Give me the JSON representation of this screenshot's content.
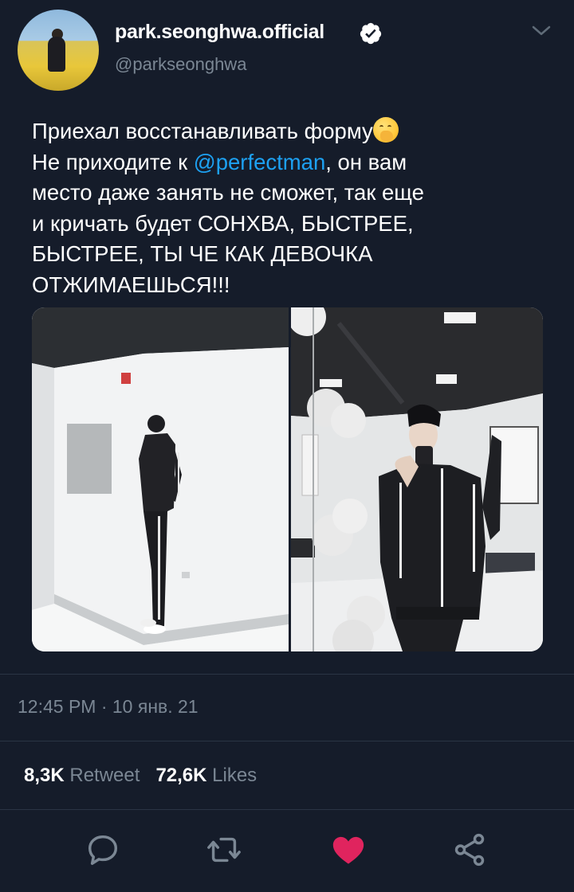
{
  "user": {
    "display_name": "park.seonghwa.official",
    "handle": "@parkseonghwa",
    "verified": true
  },
  "tweet": {
    "line1": "Приехал восстанавливать форму",
    "line2_before": "Не приходите к ",
    "mention": "@perfectman",
    "line2_after": ", он вам",
    "line3": "место даже занять не сможет, так еще",
    "line4": "и кричать будет СОНХВА, БЫСТРЕЕ,",
    "line5": "БЫСТРЕЕ, ТЫ ЧЕ КАК ДЕВОЧКА",
    "line6": "ОТЖИМАЕШЬСЯ!!!",
    "emoji_name": "face-with-hand-over-mouth"
  },
  "meta": {
    "timestamp": "12:45 PM · 10 янв. 21"
  },
  "stats": {
    "retweets_count": "8,3K",
    "retweets_label": "Retweet",
    "likes_count": "72,6K",
    "likes_label": "Likes"
  },
  "actions": {
    "reply_icon": "reply-icon",
    "retweet_icon": "retweet-icon",
    "like_icon": "heart-icon",
    "share_icon": "share-icon",
    "liked": true
  },
  "colors": {
    "background": "#151c2a",
    "link": "#1da1f2",
    "secondary_text": "#7b8794",
    "like": "#e0245e"
  }
}
